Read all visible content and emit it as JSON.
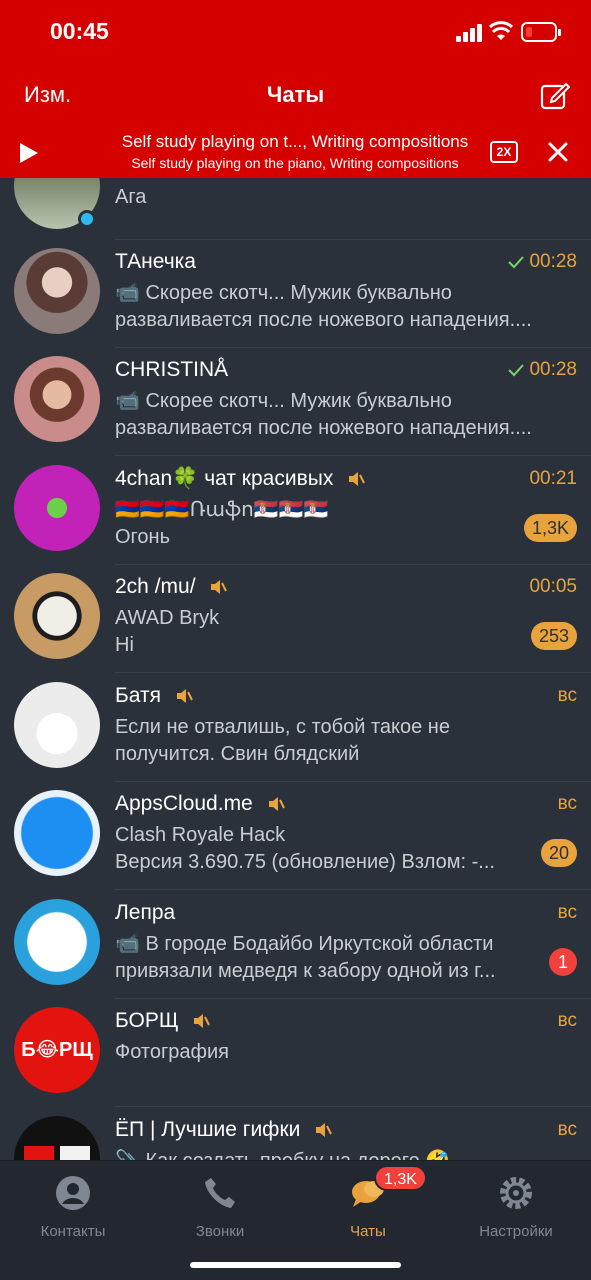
{
  "status_bar": {
    "time": "00:45"
  },
  "nav": {
    "edit_label": "Изм.",
    "title": "Чаты"
  },
  "player": {
    "line1": "Self study playing on t..., Writing compositions",
    "line2": "Self study playing on the piano, Writing compositions",
    "speed": "2X"
  },
  "chats": [
    {
      "name": "",
      "message": "Ага",
      "message2": "",
      "time": "",
      "badge": ""
    },
    {
      "name": "ТАнечка",
      "message": "📹 Скорее скотч... Мужик буквально",
      "message2": "разваливается после ножевого нападения....",
      "time": "00:28",
      "read": true,
      "badge": ""
    },
    {
      "name": "CHRISTINÅ",
      "message": "📹 Скорее скотч... Мужик буквально",
      "message2": "разваливается после ножевого нападения....",
      "time": "00:28",
      "read": true,
      "badge": ""
    },
    {
      "name": "4chan🍀 чат красивых",
      "message": "🇦🇲🇦🇲🇦🇲Ռաֆո🇷🇸🇷🇸🇷🇸",
      "message2": "Огонь",
      "time": "00:21",
      "muted": true,
      "badge": "1,3K"
    },
    {
      "name": "2ch /mu/",
      "message": "AWAD Bryk",
      "message2": "Hi",
      "time": "00:05",
      "muted": true,
      "badge": "253"
    },
    {
      "name": "Батя",
      "message": "Если не отвалишь, с тобой такое не",
      "message2": "получится. Свин блядский",
      "time": "вс",
      "muted": true,
      "badge": ""
    },
    {
      "name": "AppsCloud.me",
      "message": "Clash Royale Hack",
      "message2": "Версия 3.690.75 (обновление) Взлом: -...",
      "time": "вс",
      "muted": true,
      "badge": "20"
    },
    {
      "name": "Лепра",
      "message": "📹 В городе Бодайбо Иркутской области",
      "message2": "привязали медведя к забору одной из г...",
      "time": "вс",
      "badge": "1"
    },
    {
      "name": "БОРЩ",
      "message": "Фотография",
      "message2": "",
      "time": "вс",
      "muted": true,
      "badge": ""
    },
    {
      "name": "ЁП | Лучшие гифки",
      "message": "📎 Как создать пробку на дороге 🤣",
      "message2": "",
      "time": "вс",
      "muted": true,
      "badge": ""
    }
  ],
  "avatar_texts": {
    "borsch": "Б😂РЩ"
  },
  "tabs": [
    {
      "label": "Контакты"
    },
    {
      "label": "Звонки"
    },
    {
      "label": "Чаты",
      "badge": "1,3K"
    },
    {
      "label": "Настройки"
    }
  ],
  "colors": {
    "header": "#d50000",
    "background": "#2b313a",
    "accent": "#e8a33d",
    "unread_red": "#f0413c"
  }
}
